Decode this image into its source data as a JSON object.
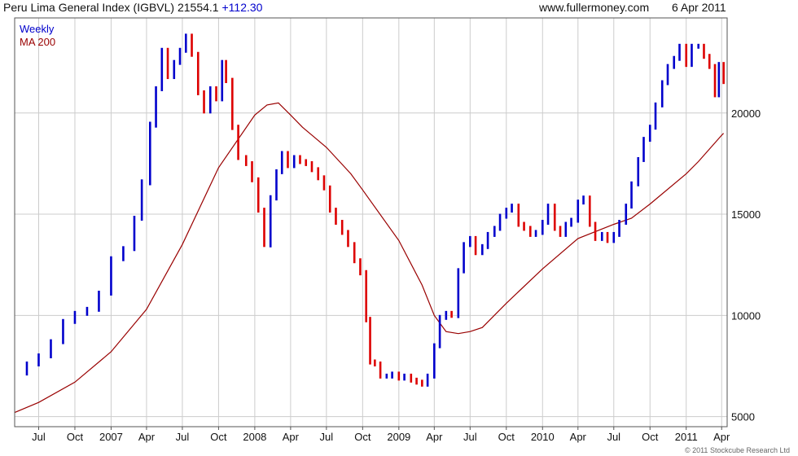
{
  "header": {
    "title": "Peru Lima General Index (IGBVL) 21554.1",
    "change": "+112.30",
    "site": "www.fullermoney.com",
    "date": "6 Apr 2011"
  },
  "copyright": "© 2011 Stockcube Research Ltd",
  "colors": {
    "up": "#0000cc",
    "down": "#dd0000",
    "ma": "#990000",
    "grid": "#cccccc",
    "frame": "#555555"
  },
  "chart_data": {
    "type": "line",
    "scale": "linear",
    "grid": true,
    "legend_position": "top-left",
    "legend": [
      "Weekly",
      "MA 200"
    ],
    "y_range": [
      4500,
      24700
    ],
    "y_ticks": [
      5000,
      10000,
      15000,
      20000
    ],
    "x_range": [
      "2006-05-01",
      "2011-04-15"
    ],
    "x_ticks": [
      {
        "date": "2006-07-01",
        "label": "Jul"
      },
      {
        "date": "2006-10-01",
        "label": "Oct"
      },
      {
        "date": "2007-01-01",
        "label": "2007"
      },
      {
        "date": "2007-04-01",
        "label": "Apr"
      },
      {
        "date": "2007-07-01",
        "label": "Jul"
      },
      {
        "date": "2007-10-01",
        "label": "Oct"
      },
      {
        "date": "2008-01-01",
        "label": "2008"
      },
      {
        "date": "2008-04-01",
        "label": "Apr"
      },
      {
        "date": "2008-07-01",
        "label": "Jul"
      },
      {
        "date": "2008-10-01",
        "label": "Oct"
      },
      {
        "date": "2009-01-01",
        "label": "2009"
      },
      {
        "date": "2009-04-01",
        "label": "Apr"
      },
      {
        "date": "2009-07-01",
        "label": "Jul"
      },
      {
        "date": "2009-10-01",
        "label": "Oct"
      },
      {
        "date": "2010-01-01",
        "label": "2010"
      },
      {
        "date": "2010-04-01",
        "label": "Apr"
      },
      {
        "date": "2010-07-01",
        "label": "Jul"
      },
      {
        "date": "2010-10-01",
        "label": "Oct"
      },
      {
        "date": "2011-01-01",
        "label": "2011"
      },
      {
        "date": "2011-04-01",
        "label": "Apr"
      }
    ],
    "series": [
      {
        "name": "Weekly",
        "style": "weekly bars",
        "points": [
          [
            "2006-05-05",
            7150
          ],
          [
            "2006-06-01",
            7600
          ],
          [
            "2006-07-01",
            8000
          ],
          [
            "2006-08-01",
            8700
          ],
          [
            "2006-09-01",
            9700
          ],
          [
            "2006-10-01",
            10100
          ],
          [
            "2006-11-01",
            10300
          ],
          [
            "2006-12-01",
            11100
          ],
          [
            "2007-01-01",
            12800
          ],
          [
            "2007-02-01",
            13300
          ],
          [
            "2007-03-01",
            14800
          ],
          [
            "2007-03-20",
            16600
          ],
          [
            "2007-04-10",
            19400
          ],
          [
            "2007-04-25",
            21200
          ],
          [
            "2007-05-10",
            23100
          ],
          [
            "2007-05-25",
            21800
          ],
          [
            "2007-06-10",
            22500
          ],
          [
            "2007-06-25",
            23100
          ],
          [
            "2007-07-10",
            23800
          ],
          [
            "2007-07-25",
            22900
          ],
          [
            "2007-08-10",
            21000
          ],
          [
            "2007-08-25",
            20100
          ],
          [
            "2007-09-10",
            21200
          ],
          [
            "2007-09-25",
            20700
          ],
          [
            "2007-10-10",
            22500
          ],
          [
            "2007-10-20",
            21600
          ],
          [
            "2007-11-05",
            19300
          ],
          [
            "2007-11-20",
            17800
          ],
          [
            "2007-12-10",
            17500
          ],
          [
            "2007-12-25",
            16700
          ],
          [
            "2008-01-10",
            15200
          ],
          [
            "2008-01-25",
            13500
          ],
          [
            "2008-02-10",
            15800
          ],
          [
            "2008-02-25",
            17100
          ],
          [
            "2008-03-10",
            18000
          ],
          [
            "2008-03-25",
            17400
          ],
          [
            "2008-04-10",
            17800
          ],
          [
            "2008-04-25",
            17600
          ],
          [
            "2008-05-10",
            17500
          ],
          [
            "2008-05-25",
            17200
          ],
          [
            "2008-06-10",
            16800
          ],
          [
            "2008-06-25",
            16300
          ],
          [
            "2008-07-10",
            15200
          ],
          [
            "2008-07-25",
            14600
          ],
          [
            "2008-08-10",
            14100
          ],
          [
            "2008-08-25",
            13500
          ],
          [
            "2008-09-10",
            12700
          ],
          [
            "2008-09-25",
            12100
          ],
          [
            "2008-10-10",
            9800
          ],
          [
            "2008-10-20",
            7700
          ],
          [
            "2008-11-01",
            7600
          ],
          [
            "2008-11-15",
            7000
          ],
          [
            "2008-12-01",
            7000
          ],
          [
            "2008-12-15",
            7100
          ],
          [
            "2009-01-01",
            6900
          ],
          [
            "2009-01-15",
            7000
          ],
          [
            "2009-02-01",
            6800
          ],
          [
            "2009-02-15",
            6700
          ],
          [
            "2009-03-01",
            6600
          ],
          [
            "2009-03-15",
            7000
          ],
          [
            "2009-04-01",
            8500
          ],
          [
            "2009-04-15",
            9900
          ],
          [
            "2009-05-01",
            10100
          ],
          [
            "2009-05-15",
            10000
          ],
          [
            "2009-06-01",
            12200
          ],
          [
            "2009-06-15",
            13500
          ],
          [
            "2009-07-01",
            13800
          ],
          [
            "2009-07-15",
            13100
          ],
          [
            "2009-08-01",
            13400
          ],
          [
            "2009-08-15",
            14000
          ],
          [
            "2009-09-01",
            14300
          ],
          [
            "2009-09-15",
            14900
          ],
          [
            "2009-10-01",
            15200
          ],
          [
            "2009-10-15",
            15400
          ],
          [
            "2009-11-01",
            14500
          ],
          [
            "2009-11-15",
            14300
          ],
          [
            "2009-12-01",
            14000
          ],
          [
            "2009-12-15",
            14100
          ],
          [
            "2010-01-01",
            14600
          ],
          [
            "2010-01-15",
            15400
          ],
          [
            "2010-02-01",
            14300
          ],
          [
            "2010-02-15",
            14000
          ],
          [
            "2010-03-01",
            14500
          ],
          [
            "2010-03-15",
            14700
          ],
          [
            "2010-04-01",
            15600
          ],
          [
            "2010-04-15",
            15800
          ],
          [
            "2010-05-01",
            14500
          ],
          [
            "2010-05-15",
            13800
          ],
          [
            "2010-06-01",
            14000
          ],
          [
            "2010-06-15",
            13700
          ],
          [
            "2010-07-01",
            14000
          ],
          [
            "2010-07-15",
            14600
          ],
          [
            "2010-08-01",
            15400
          ],
          [
            "2010-08-15",
            16500
          ],
          [
            "2010-09-01",
            17700
          ],
          [
            "2010-09-15",
            18700
          ],
          [
            "2010-10-01",
            19300
          ],
          [
            "2010-10-15",
            20400
          ],
          [
            "2010-11-01",
            21500
          ],
          [
            "2010-11-15",
            22300
          ],
          [
            "2010-12-01",
            22700
          ],
          [
            "2010-12-15",
            23300
          ],
          [
            "2011-01-01",
            22400
          ],
          [
            "2011-01-15",
            23300
          ],
          [
            "2011-02-01",
            23300
          ],
          [
            "2011-02-15",
            22800
          ],
          [
            "2011-03-01",
            22300
          ],
          [
            "2011-03-15",
            20900
          ],
          [
            "2011-03-25",
            22400
          ],
          [
            "2011-04-06",
            21554
          ]
        ]
      },
      {
        "name": "MA 200",
        "style": "line",
        "points": [
          [
            "2006-05-01",
            5200
          ],
          [
            "2006-07-01",
            5700
          ],
          [
            "2006-10-01",
            6700
          ],
          [
            "2007-01-01",
            8200
          ],
          [
            "2007-04-01",
            10300
          ],
          [
            "2007-07-01",
            13500
          ],
          [
            "2007-10-01",
            17300
          ],
          [
            "2008-01-01",
            19900
          ],
          [
            "2008-02-01",
            20400
          ],
          [
            "2008-03-01",
            20500
          ],
          [
            "2008-04-01",
            19900
          ],
          [
            "2008-05-01",
            19300
          ],
          [
            "2008-07-01",
            18300
          ],
          [
            "2008-09-01",
            17000
          ],
          [
            "2008-10-01",
            16200
          ],
          [
            "2009-01-01",
            13700
          ],
          [
            "2009-03-01",
            11500
          ],
          [
            "2009-04-01",
            10000
          ],
          [
            "2009-05-01",
            9200
          ],
          [
            "2009-06-01",
            9100
          ],
          [
            "2009-07-01",
            9200
          ],
          [
            "2009-08-01",
            9400
          ],
          [
            "2009-10-01",
            10600
          ],
          [
            "2010-01-01",
            12300
          ],
          [
            "2010-04-01",
            13800
          ],
          [
            "2010-07-01",
            14500
          ],
          [
            "2010-08-15",
            14800
          ],
          [
            "2010-10-01",
            15500
          ],
          [
            "2011-01-01",
            17000
          ],
          [
            "2011-02-01",
            17600
          ],
          [
            "2011-04-01",
            18900
          ],
          [
            "2011-04-06",
            19000
          ]
        ]
      }
    ]
  }
}
